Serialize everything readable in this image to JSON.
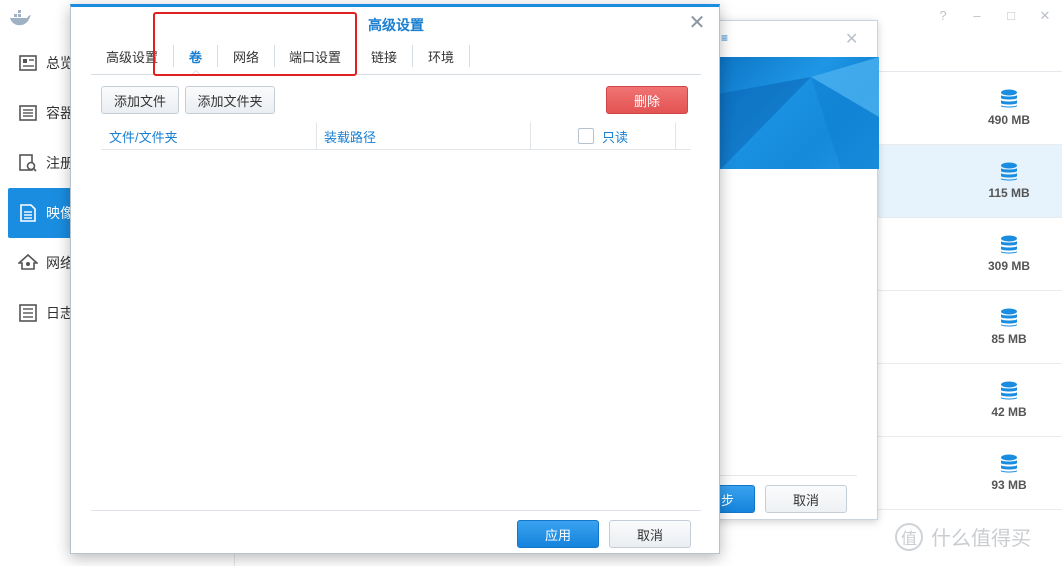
{
  "app": {
    "window_controls": [
      "?",
      "–",
      "□",
      "✕"
    ]
  },
  "sidebar": {
    "items": [
      {
        "label": "总览",
        "icon": "overview-icon"
      },
      {
        "label": "容器",
        "icon": "container-icon"
      },
      {
        "label": "注册",
        "icon": "registry-icon"
      },
      {
        "label": "映像",
        "icon": "image-icon",
        "active": true
      },
      {
        "label": "网络",
        "icon": "network-icon"
      },
      {
        "label": "日志",
        "icon": "log-icon"
      }
    ]
  },
  "image_list": {
    "sizes": [
      "490 MB",
      "115 MB",
      "309 MB",
      "85 MB",
      "42 MB",
      "93 MB"
    ],
    "selected_index": 1
  },
  "wizard": {
    "title_fragment": "≡",
    "next_label": "步",
    "cancel_label": "取消"
  },
  "dialog": {
    "title": "高级设置",
    "tabs": [
      {
        "label": "高级设置"
      },
      {
        "label": "卷",
        "active": true
      },
      {
        "label": "网络"
      },
      {
        "label": "端口设置"
      },
      {
        "label": "链接"
      },
      {
        "label": "环境"
      }
    ],
    "toolbar": {
      "add_file": "添加文件",
      "add_folder": "添加文件夹",
      "delete": "删除"
    },
    "grid": {
      "columns": [
        "文件/文件夹",
        "装载路径",
        "只读"
      ],
      "readonly_checked": false
    },
    "footer": {
      "apply": "应用",
      "cancel": "取消"
    }
  },
  "watermark": {
    "text": "什么值得买",
    "glyph": "值"
  },
  "colors": {
    "accent": "#1a8de0",
    "danger": "#e45353",
    "highlight": "#e02020"
  }
}
